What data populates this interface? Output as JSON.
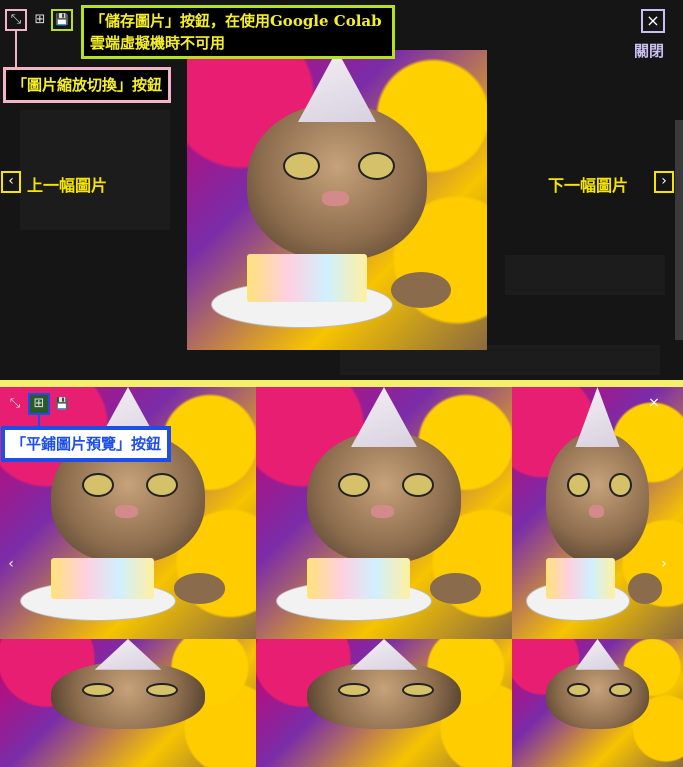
{
  "top_viewer": {
    "callout_save": "「儲存圖片」按鈕，在使用Google Colab雲端虛擬機時不可用",
    "callout_zoom": "「圖片縮放切換」按鈕",
    "prev_label": "上一幅圖片",
    "next_label": "下一幅圖片",
    "close_label": "關閉",
    "zoom_icon_glyph": "⤡",
    "grid_icon_glyph": "⊞",
    "save_icon_glyph": "💾",
    "prev_glyph": "‹",
    "next_glyph": "›",
    "close_glyph": "×"
  },
  "bottom_viewer": {
    "callout_tile": "「平鋪圖片預覽」按鈕",
    "zoom_icon_glyph": "⤡",
    "grid_icon_glyph": "⊞",
    "save_icon_glyph": "💾",
    "prev_glyph": "‹",
    "next_glyph": "›",
    "close_glyph": "×"
  },
  "colors": {
    "divider": "#f5ef6a",
    "highlight_pink": "#f2b5c7",
    "highlight_green": "#b5e21f",
    "highlight_blue": "#1d4fe8",
    "highlight_yellow": "#f5e500",
    "highlight_lavender": "#c9c0ef"
  }
}
